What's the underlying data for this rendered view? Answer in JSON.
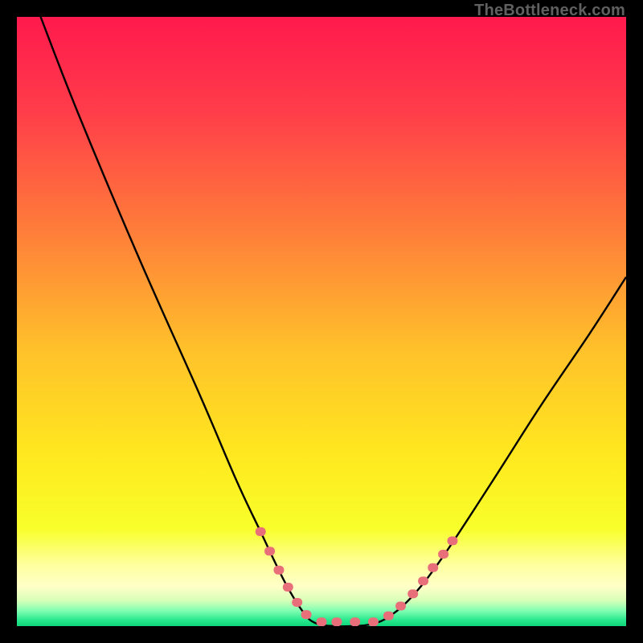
{
  "watermark": "TheBottleneck.com",
  "chart_data": {
    "type": "line",
    "title": "",
    "xlabel": "",
    "ylabel": "",
    "xlim": [
      0,
      100
    ],
    "ylim": [
      0,
      100
    ],
    "curve": [
      {
        "x": 3.9,
        "y": 100.0
      },
      {
        "x": 10.0,
        "y": 84.3
      },
      {
        "x": 20.0,
        "y": 60.5
      },
      {
        "x": 30.0,
        "y": 38.0
      },
      {
        "x": 36.0,
        "y": 24.0
      },
      {
        "x": 40.0,
        "y": 15.5
      },
      {
        "x": 44.0,
        "y": 7.2
      },
      {
        "x": 47.0,
        "y": 2.3
      },
      {
        "x": 49.0,
        "y": 0.5
      },
      {
        "x": 52.0,
        "y": 0.0
      },
      {
        "x": 55.0,
        "y": 0.0
      },
      {
        "x": 58.0,
        "y": 0.3
      },
      {
        "x": 61.0,
        "y": 1.5
      },
      {
        "x": 65.0,
        "y": 5.0
      },
      {
        "x": 70.0,
        "y": 11.5
      },
      {
        "x": 78.0,
        "y": 23.7
      },
      {
        "x": 86.0,
        "y": 36.2
      },
      {
        "x": 94.0,
        "y": 48.0
      },
      {
        "x": 100.0,
        "y": 57.3
      }
    ],
    "bad_zone_markers": [
      {
        "x": 40.0,
        "y": 15.5
      },
      {
        "x": 41.5,
        "y": 12.3
      },
      {
        "x": 43.0,
        "y": 9.2
      },
      {
        "x": 44.5,
        "y": 6.4
      },
      {
        "x": 46.0,
        "y": 3.9
      },
      {
        "x": 47.5,
        "y": 1.9
      },
      {
        "x": 50.0,
        "y": 0.7
      },
      {
        "x": 52.5,
        "y": 0.7
      },
      {
        "x": 55.5,
        "y": 0.7
      },
      {
        "x": 58.5,
        "y": 0.7
      },
      {
        "x": 61.0,
        "y": 1.7
      },
      {
        "x": 63.0,
        "y": 3.3
      },
      {
        "x": 65.0,
        "y": 5.3
      },
      {
        "x": 66.7,
        "y": 7.4
      },
      {
        "x": 68.3,
        "y": 9.6
      },
      {
        "x": 70.0,
        "y": 11.8
      },
      {
        "x": 71.5,
        "y": 14.0
      }
    ],
    "gradient_stops": [
      {
        "offset": 0.0,
        "color": "#ff1a4d"
      },
      {
        "offset": 0.15,
        "color": "#ff3b4a"
      },
      {
        "offset": 0.35,
        "color": "#ff7d3a"
      },
      {
        "offset": 0.55,
        "color": "#ffc22a"
      },
      {
        "offset": 0.72,
        "color": "#ffe81f"
      },
      {
        "offset": 0.84,
        "color": "#f8ff2a"
      },
      {
        "offset": 0.9,
        "color": "#ffffa0"
      },
      {
        "offset": 0.935,
        "color": "#ffffc8"
      },
      {
        "offset": 0.958,
        "color": "#d7ffb8"
      },
      {
        "offset": 0.975,
        "color": "#7fffb2"
      },
      {
        "offset": 0.99,
        "color": "#28e88e"
      },
      {
        "offset": 1.0,
        "color": "#0fd67a"
      }
    ]
  },
  "colors": {
    "curve": "#000000",
    "dot_fill": "#e86f7a",
    "background": "#000000"
  }
}
